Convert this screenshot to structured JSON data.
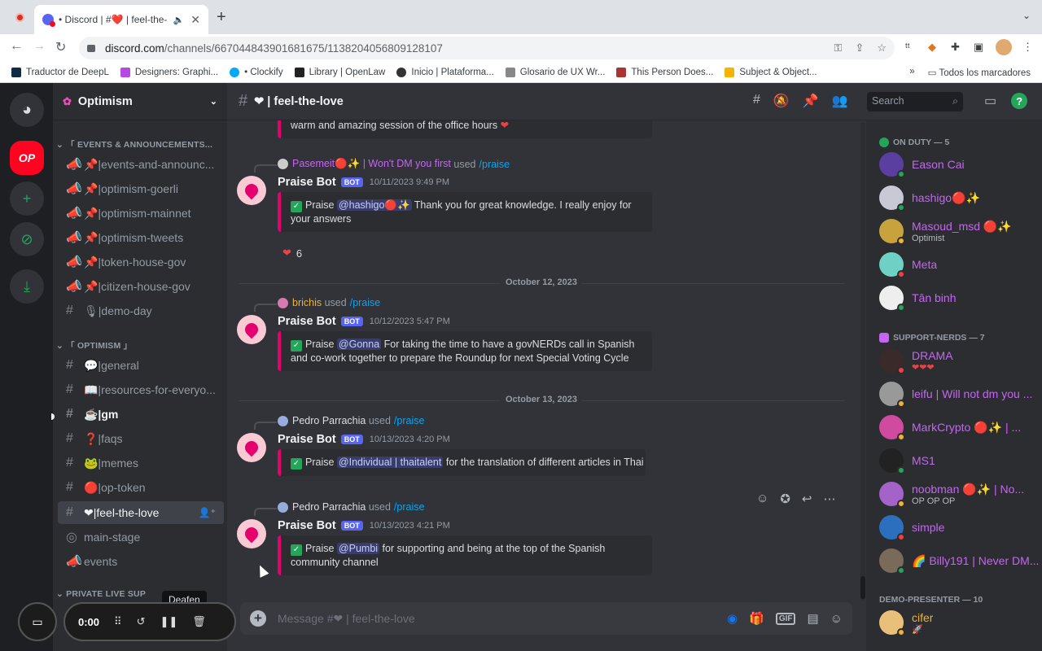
{
  "browser": {
    "tab_title": "• Discord | #❤️ | feel-the-",
    "url_domain": "discord.com",
    "url_path": "/channels/667044843901681675/1138204056809128107",
    "bookmarks": [
      "Traductor de DeepL",
      "Designers: Graphi...",
      "• Clockify",
      "Library | OpenLaw",
      "Inicio | Plataforma...",
      "Glosario de UX Wr...",
      "This Person Does...",
      "Subject & Object..."
    ],
    "bookmarks_more": "»",
    "bookmarks_all": "Todos los marcadores"
  },
  "guilds": {
    "op_label": "OP"
  },
  "server": {
    "name": "Optimism",
    "categories": [
      "「 EVENTS & ANNOUNCEMENTS...",
      "「 OPTIMISM 」",
      "PRIVATE LIVE SUP"
    ],
    "channels": [
      {
        "icon": "📣",
        "label": "📌|events-and-announc..."
      },
      {
        "icon": "📣",
        "label": "📌|optimism-goerli"
      },
      {
        "icon": "📣",
        "label": "📌|optimism-mainnet"
      },
      {
        "icon": "📣",
        "label": "📌|optimism-tweets"
      },
      {
        "icon": "📣",
        "label": "📌|token-house-gov"
      },
      {
        "icon": "📣",
        "label": "📌|citizen-house-gov"
      },
      {
        "icon": "#",
        "label": "🎙|demo-day"
      },
      {
        "icon": "#",
        "label": "💬|general"
      },
      {
        "icon": "#",
        "label": "📖|resources-for-everyo..."
      },
      {
        "icon": "#",
        "label": "☕|gm"
      },
      {
        "icon": "#",
        "label": "❓|faqs"
      },
      {
        "icon": "#",
        "label": "🐸|memes"
      },
      {
        "icon": "#",
        "label": "🔴|op-token"
      },
      {
        "icon": "#",
        "label": "❤|feel-the-love"
      },
      {
        "icon": "◎",
        "label": "main-stage"
      },
      {
        "icon": "📣",
        "label": "events"
      }
    ],
    "tooltip": "Deafen"
  },
  "recorder": {
    "time": "0:00"
  },
  "channel_header": {
    "name": "❤ | feel-the-love",
    "search_placeholder": "Search"
  },
  "messages": {
    "top_fragment": "warm and amazing session of the office hours",
    "dates": [
      "October 12, 2023",
      "October 13, 2023"
    ],
    "items": [
      {
        "invoker": "Pasemeit🔴✨ | Won't DM you first",
        "used": "used",
        "command": "/praise",
        "author": "Praise Bot",
        "badge": "BOT",
        "time": "10/11/2023 9:49 PM",
        "praise": "Praise",
        "mention": "@hashigo🔴✨",
        "text": "Thank you for great knowledge. I really enjoy for your answers"
      },
      {
        "invoker": "brichis",
        "used": "used",
        "command": "/praise",
        "author": "Praise Bot",
        "badge": "BOT",
        "time": "10/12/2023 5:47 PM",
        "praise": "Praise",
        "mention": "@Gonna",
        "text": "For taking the time to have a govNERDs call in Spanish and co-work together to prepare the Roundup for next Special Voting Cycle"
      },
      {
        "invoker": "Pedro Parrachia",
        "used": "used",
        "command": "/praise",
        "author": "Praise Bot",
        "badge": "BOT",
        "time": "10/13/2023 4:20 PM",
        "praise": "Praise",
        "mention": "@Individual | thaitalent",
        "text": "for the translation of different articles in Thai"
      },
      {
        "invoker": "Pedro Parrachia",
        "used": "used",
        "command": "/praise",
        "author": "Praise Bot",
        "badge": "BOT",
        "time": "10/13/2023 4:21 PM",
        "praise": "Praise",
        "mention": "@Pumbi",
        "text": "for supporting and being at the top of the Spanish community channel"
      }
    ],
    "reaction_count": "6"
  },
  "composer": {
    "placeholder": "Message #❤ | feel-the-love",
    "gif": "GIF"
  },
  "members": {
    "groups": [
      "ON DUTY — 5",
      "SUPPORT-NERDS — 7",
      "DEMO-PRESENTER — 10"
    ],
    "list": [
      {
        "name": "Eason Cai",
        "sub": ""
      },
      {
        "name": "hashigo🔴✨",
        "sub": ""
      },
      {
        "name": "Masoud_msd 🔴✨",
        "sub": "Optimist"
      },
      {
        "name": "Meta",
        "sub": ""
      },
      {
        "name": "Tân binh",
        "sub": ""
      },
      {
        "name": "DRAMA",
        "sub": "❤❤❤"
      },
      {
        "name": "leifu | Will not dm you ...",
        "sub": ""
      },
      {
        "name": "MarkCrypto 🔴✨ | ...",
        "sub": ""
      },
      {
        "name": "MS1",
        "sub": ""
      },
      {
        "name": "noobman 🔴✨ | No...",
        "sub": "OP OP OP"
      },
      {
        "name": "simple",
        "sub": ""
      },
      {
        "name": "🌈 Billy191 | Never DM...",
        "sub": ""
      },
      {
        "name": "cifer",
        "sub": "🚀"
      }
    ]
  },
  "colors": {
    "accent": "#5865f2",
    "op_red": "#ff0420",
    "praise_pink": "#e6006e",
    "online": "#23a55a"
  }
}
